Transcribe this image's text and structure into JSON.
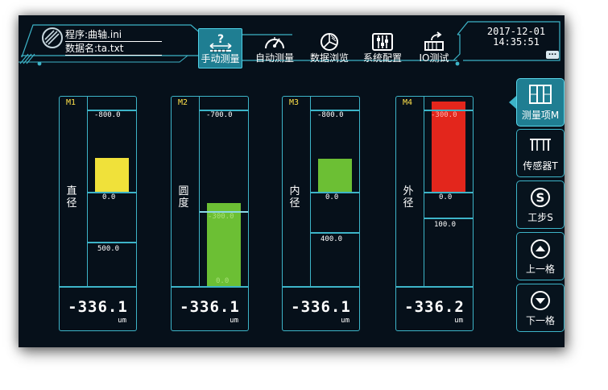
{
  "header": {
    "program_label": "程序:曲轴.ini",
    "data_label": "数据名:ta.txt",
    "date": "2017-12-01",
    "time": "14:35:51",
    "more_label": "..."
  },
  "tabs": [
    {
      "label": "手动测量",
      "icon": "manual-measure-icon",
      "active": true
    },
    {
      "label": "自动测量",
      "icon": "gauge-icon",
      "active": false
    },
    {
      "label": "数据浏览",
      "icon": "pie-chart-icon",
      "active": false
    },
    {
      "label": "系统配置",
      "icon": "sliders-icon",
      "active": false
    },
    {
      "label": "IO测试",
      "icon": "io-test-icon",
      "active": false
    }
  ],
  "panels": [
    {
      "id": "M1",
      "name": "直径",
      "ticks": [
        "-800.0",
        "0.0",
        "500.0"
      ],
      "reading": "-336.1",
      "unit": "um",
      "bar_color": "#f0e13a",
      "bar_range": [
        0.0,
        -336.1
      ],
      "scale_min": -800.0,
      "scale_max": 500.0
    },
    {
      "id": "M2",
      "name": "圆度",
      "ticks": [
        "-700.0",
        "-300.0",
        "0.0"
      ],
      "reading": "-336.1",
      "unit": "um",
      "bar_color": "#6cbf34",
      "bar_range": [
        0.0,
        -336.1
      ],
      "scale_min": -700.0,
      "scale_max": 0.0
    },
    {
      "id": "M3",
      "name": "内径",
      "ticks": [
        "-800.0",
        "0.0",
        "400.0"
      ],
      "reading": "-336.1",
      "unit": "um",
      "bar_color": "#6cbf34",
      "bar_range": [
        0.0,
        -336.1
      ],
      "scale_min": -800.0,
      "scale_max": 400.0
    },
    {
      "id": "M4",
      "name": "外径",
      "ticks": [
        "-300.0",
        "0.0",
        "100.0"
      ],
      "reading": "-336.2",
      "unit": "um",
      "bar_color": "#e3261c",
      "bar_range": [
        0.0,
        -336.2
      ],
      "scale_min": -300.0,
      "scale_max": 100.0
    }
  ],
  "side_buttons": [
    {
      "label": "测量项M",
      "icon": "measure-item-icon",
      "active": true
    },
    {
      "label": "传感器T",
      "icon": "sensor-icon",
      "active": false
    },
    {
      "label": "工步S",
      "icon": "step-s-icon",
      "active": false
    },
    {
      "label": "上一格",
      "icon": "up-arrow-icon",
      "active": false
    },
    {
      "label": "下一格",
      "icon": "down-arrow-icon",
      "active": false
    }
  ],
  "colors": {
    "accent": "#3db4c8",
    "active_fill": "#1f7e92",
    "background": "#06101a",
    "panel_label": "#ffe14a"
  }
}
